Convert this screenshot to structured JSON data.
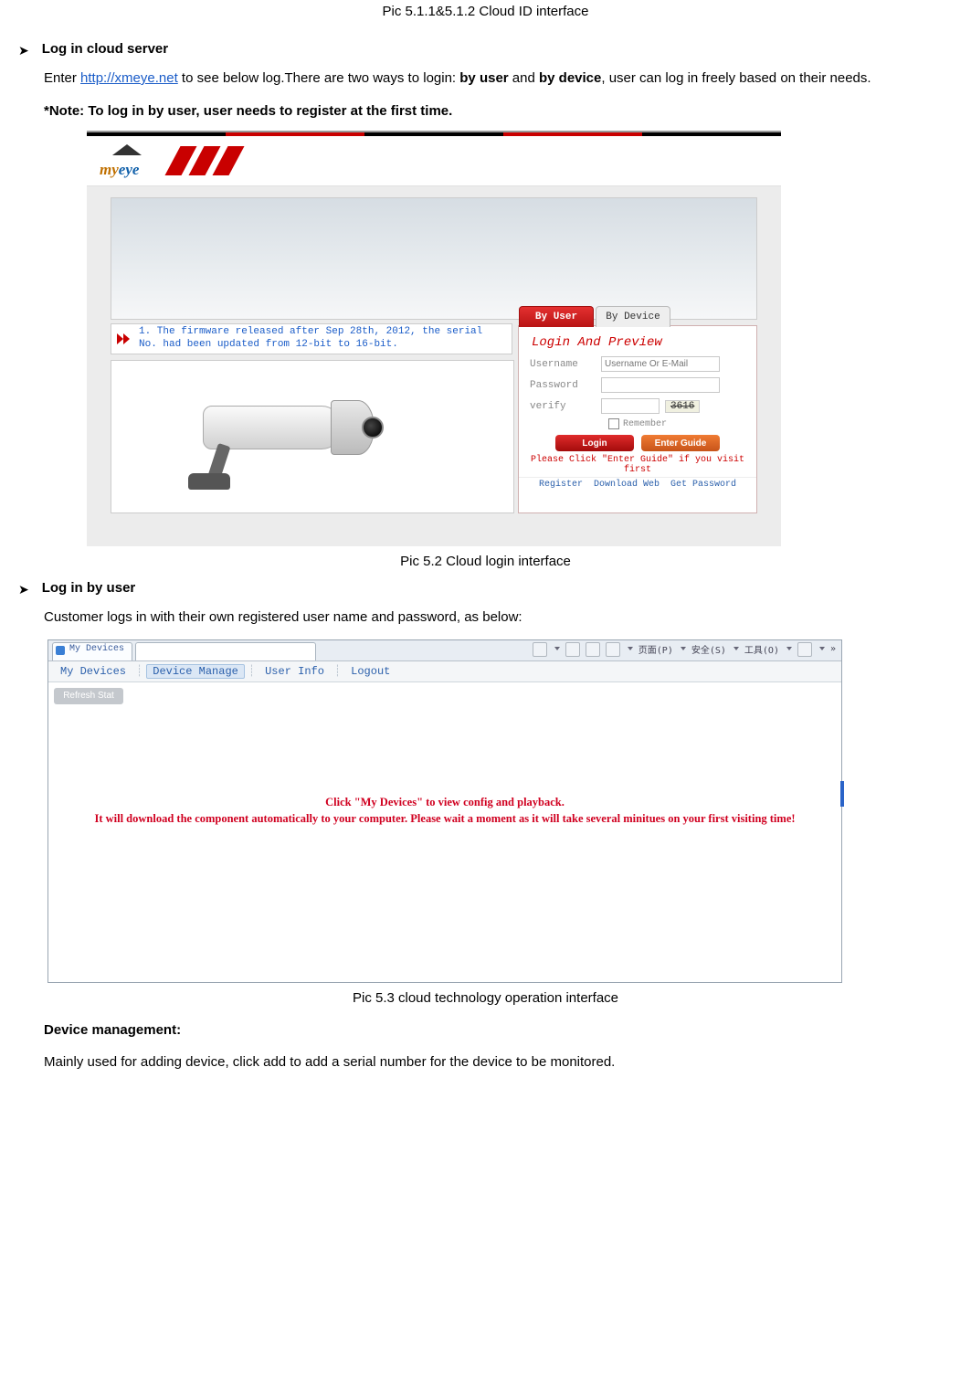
{
  "captions": {
    "top": "Pic 5.1.1&5.1.2    Cloud ID interface",
    "fig52": "Pic 5.2 Cloud login interface",
    "fig53": "Pic 5.3 cloud technology operation interface"
  },
  "sections": {
    "s1_title": "Log in cloud server",
    "s1_p_pre": "Enter ",
    "s1_link": "http://xmeye.net",
    "s1_p_mid": " to see below log.There are two ways to login: ",
    "s1_bold_a": "by user",
    "s1_p_mid2": " and ",
    "s1_bold_b": "by device",
    "s1_p_post": ", user can log in freely based on their needs.",
    "s1_note": "*Note: To log in by user, user needs to register at the first time.",
    "s2_title": "Log in by user",
    "s2_p": "Customer logs in with their own registered user name and password, as below:",
    "s3_title": "Device management:",
    "s3_p": "Mainly used for adding device, click add to add a serial number for the device to be monitored."
  },
  "shot1": {
    "logo_text_a": "my",
    "logo_text_b": "eye",
    "notice_line": "1.  The firmware released after Sep 28th, 2012, the serial No. had been updated from 12-bit to 16-bit.",
    "tabs": {
      "by_user": "By User",
      "by_device": "By Device"
    },
    "login_title": "Login And Preview",
    "labels": {
      "username": "Username",
      "password": "Password",
      "verify": "verify"
    },
    "placeholders": {
      "username": "Username Or E-Mail"
    },
    "captcha": "3616",
    "remember": "Remember",
    "buttons": {
      "login": "Login",
      "guide": "Enter Guide"
    },
    "hint": "Please Click \"Enter Guide\" if you visit first",
    "links": {
      "register": "Register",
      "download": "Download Web",
      "getpwd": "Get Password"
    }
  },
  "shot2": {
    "tab_title": "My Devices",
    "toolbar_items": [
      "页面(P)",
      "安全(S)",
      "工具(O)"
    ],
    "menu": {
      "my_devices": "My Devices",
      "device_manage": "Device Manage",
      "user_info": "User Info",
      "logout": "Logout"
    },
    "side_tab": "Refresh Stat",
    "red_line1": "Click \"My Devices\" to view config and playback.",
    "red_line2": "It will download the component automatically to your computer. Please wait a moment as it will take several minitues on your first visiting time!"
  }
}
